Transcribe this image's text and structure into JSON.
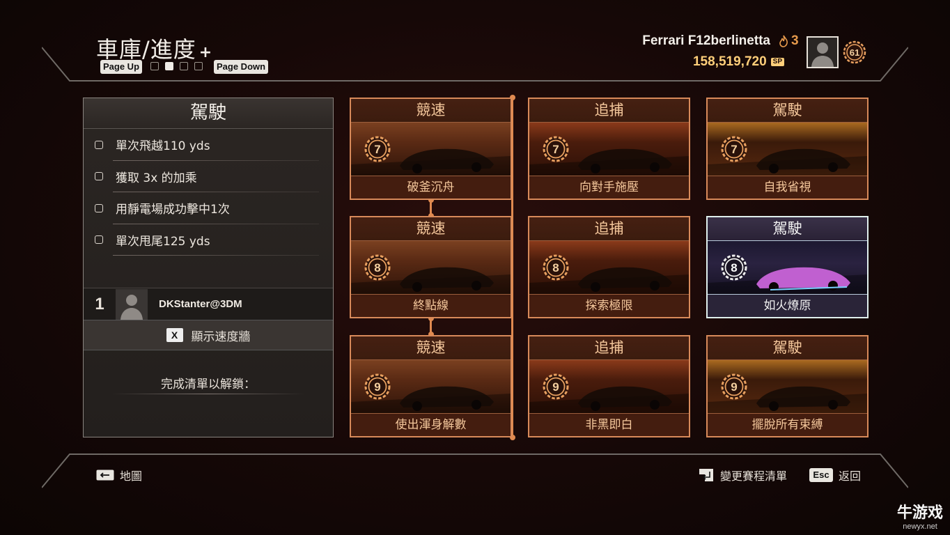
{
  "header": {
    "title": "車庫/進度",
    "plus": "+",
    "page_up": "Page Up",
    "page_down": "Page Down",
    "pages": 4,
    "current_page": 2
  },
  "player": {
    "car": "Ferrari F12berlinetta",
    "heat": "3",
    "sp": "158,519,720",
    "sp_unit": "SP",
    "level": "61"
  },
  "panel": {
    "title": "駕駛",
    "tasks": [
      "單次飛越110 yds",
      "獲取 3x 的加乘",
      "用靜電場成功擊中1次",
      "單次甩尾125 yds"
    ],
    "leader_rank": "1",
    "leader_name": "DKStanter@3DM",
    "speedwall_key": "X",
    "speedwall_label": "顯示速度牆",
    "unlock_text": "完成清單以解鎖："
  },
  "events": [
    {
      "category": "競速",
      "level": "7",
      "name": "破釜沉舟"
    },
    {
      "category": "追捕",
      "level": "7",
      "name": "向對手施壓"
    },
    {
      "category": "駕駛",
      "level": "7",
      "name": "自我省視"
    },
    {
      "category": "競速",
      "level": "8",
      "name": "終點線"
    },
    {
      "category": "追捕",
      "level": "8",
      "name": "探索極限"
    },
    {
      "category": "駕駛",
      "level": "8",
      "name": "如火燎原"
    },
    {
      "category": "競速",
      "level": "9",
      "name": "使出渾身解數"
    },
    {
      "category": "追捕",
      "level": "9",
      "name": "非黑即白"
    },
    {
      "category": "駕駛",
      "level": "9",
      "name": "擺脫所有束縛"
    }
  ],
  "footer": {
    "map": "地圖",
    "change_list": "變更賽程清單",
    "esc_key": "Esc",
    "back": "返回"
  },
  "watermark": {
    "name": "牛游戏",
    "url": "newyx.net"
  },
  "colors": {
    "accent": "#d88a5a",
    "sp_gold": "#ffcf7a",
    "heat_orange": "#e79a4c",
    "selected_border": "#e0f0ee"
  }
}
